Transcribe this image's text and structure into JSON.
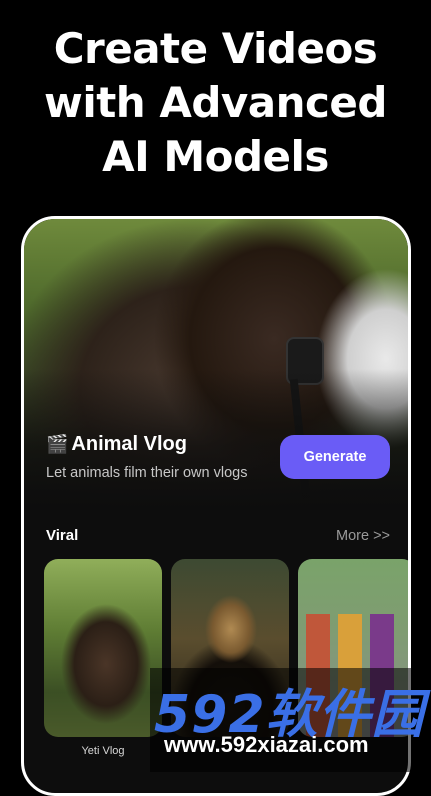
{
  "headline": {
    "line1": "Create Videos",
    "line2": "with Advanced",
    "line3": "AI Models"
  },
  "hero": {
    "emoji": "🎬",
    "title": "Animal Vlog",
    "subtitle": "Let animals film their own vlogs",
    "generate_label": "Generate"
  },
  "viral": {
    "title": "Viral",
    "more_label": "More >>",
    "cards": [
      {
        "label": "Yeti Vlog"
      },
      {
        "label": ""
      },
      {
        "label": ""
      }
    ]
  },
  "watermark": {
    "logo": "592软件园",
    "url": "www.592xiazai.com"
  },
  "colors": {
    "accent": "#6a5cf6",
    "background": "#000000",
    "watermark_blue": "#3a6fe6"
  }
}
